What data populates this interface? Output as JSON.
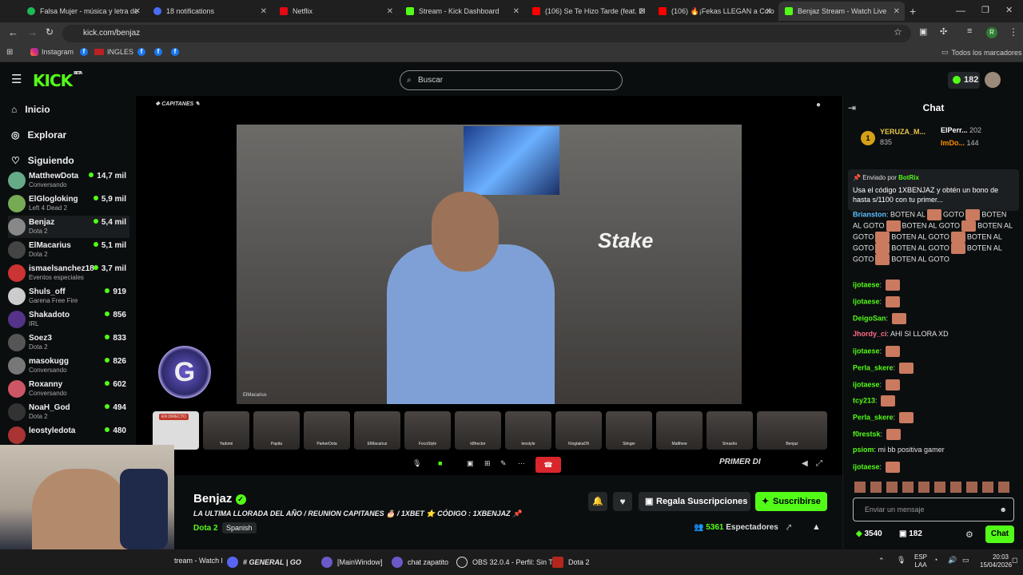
{
  "browser": {
    "tabs": [
      {
        "title": "Falsa Mujer - música y letra de",
        "color": "#1db954"
      },
      {
        "title": "18 notifications",
        "color": "#4a6cf7"
      },
      {
        "title": "Netflix",
        "color": "#e50914"
      },
      {
        "title": "Stream - Kick Dashboard",
        "color": "#53fc18"
      },
      {
        "title": "(106) Se Te Hizo Tarde (feat. El",
        "color": "#ff0000"
      },
      {
        "title": "(106) 🔥¡Fekas LLEGAN a Colo",
        "color": "#ff0000"
      },
      {
        "title": "Benjaz Stream - Watch Live",
        "color": "#53fc18"
      }
    ],
    "url": "kick.com/benjaz",
    "bookmarks": [
      "Instagram",
      "INGLES"
    ],
    "all_bookmarks": "Todos los marcadores"
  },
  "kick": {
    "logo": "KICK",
    "logo_beta": "BETA",
    "search_placeholder": "Buscar",
    "points": "182",
    "accent": "#53fc18"
  },
  "sidebar": {
    "nav": [
      "Inicio",
      "Explorar",
      "Siguiendo"
    ],
    "following": [
      {
        "name": "MatthewDota",
        "game": "Conversando",
        "viewers": "14,7 mil",
        "color": "#6a8"
      },
      {
        "name": "ElGlogloking",
        "game": "Left 4 Dead 2",
        "viewers": "5,9 mil",
        "color": "#7a5"
      },
      {
        "name": "Benjaz",
        "game": "Dota 2",
        "viewers": "5,4 mil",
        "color": "#888"
      },
      {
        "name": "ElMacarius",
        "game": "Dota 2",
        "viewers": "5,1 mil",
        "color": "#444"
      },
      {
        "name": "ismaelsanchez18",
        "game": "Eventos especiales",
        "viewers": "3,7 mil",
        "color": "#c33"
      },
      {
        "name": "Shuls_off",
        "game": "Garena Free Fire",
        "viewers": "919",
        "color": "#ccc"
      },
      {
        "name": "Shakadoto",
        "game": "IRL",
        "viewers": "856",
        "color": "#538"
      },
      {
        "name": "Soez3",
        "game": "Dota 2",
        "viewers": "833",
        "color": "#555"
      },
      {
        "name": "masokugg",
        "game": "Conversando",
        "viewers": "826",
        "color": "#777"
      },
      {
        "name": "Roxanny",
        "game": "Conversando",
        "viewers": "602",
        "color": "#c56"
      },
      {
        "name": "NoaH_God",
        "game": "Dota 2",
        "viewers": "494",
        "color": "#333"
      },
      {
        "name": "leostyledota",
        "game": "",
        "viewers": "480",
        "color": "#a33"
      }
    ]
  },
  "stream": {
    "overlay_title": "CAPITANES",
    "video_caption": "ElMacarius",
    "thumbs": [
      "EN DIRECTO",
      "Yadomi",
      "Papita",
      "ParkerDota",
      "ElMacarius",
      "FocoStyle",
      "k8hector",
      "leostyle",
      "KingtakaOfi",
      "Stinger",
      "Matthew",
      "Smasho",
      "Benjaz"
    ],
    "banner": "PRIMER DI",
    "streamer": "Benjaz",
    "title": "LA ULTIMA LLORADA DEL AÑO / REUNION CAPITANES 🎂 / 1XBET ⭐ CÓDIGO : 1XBENJAZ 📌",
    "game": "Dota 2",
    "language": "Spanish",
    "gift_label": "Regala Suscripciones",
    "subscribe_label": "Suscribirse",
    "viewers": "5361",
    "viewers_label": "Espectadores"
  },
  "chat": {
    "header": "Chat",
    "leaders": [
      {
        "rank": "1",
        "name": "YERUZA_M...",
        "count": "835"
      },
      {
        "name": "ElPerr...",
        "count": "202"
      },
      {
        "name": "ImDo...",
        "count": "144"
      }
    ],
    "pinned_by": "Enviado por",
    "pinned_user": "BotRix",
    "pinned_text": "Usa el código 1XBENJAZ y obtén un bono de hasta s/1100 con tu primer...",
    "messages": [
      {
        "user": "Brianston",
        "color": "#5ec1ff",
        "text": "BOTEN AL GOTO"
      },
      {
        "user": "ijotaese",
        "color": "#53fc18",
        "text": ""
      },
      {
        "user": "ijotaese",
        "color": "#53fc18",
        "text": ""
      },
      {
        "user": "DeigoSan",
        "color": "#53fc18",
        "text": ""
      },
      {
        "user": "Jhordy_ci",
        "color": "#ff6b8a",
        "text": "AHI SI LLORA XD"
      },
      {
        "user": "ijotaese",
        "color": "#53fc18",
        "text": ""
      },
      {
        "user": "Perla_skere",
        "color": "#53fc18",
        "text": ""
      },
      {
        "user": "ijotaese",
        "color": "#53fc18",
        "text": ""
      },
      {
        "user": "tcy213",
        "color": "#53fc18",
        "text": ""
      },
      {
        "user": "Perla_skere",
        "color": "#53fc18",
        "text": ""
      },
      {
        "user": "f0restsk",
        "color": "#53fc18",
        "text": ""
      },
      {
        "user": "psiom",
        "color": "#53fc18",
        "text": "mi bb positiva gamer"
      },
      {
        "user": "ijotaese",
        "color": "#53fc18",
        "text": ""
      }
    ],
    "boten_lines": [
      "BOTEN AL",
      "GOTO",
      "BOTEN AL GOTO",
      "BOTEN AL",
      "GOTO",
      "BOTEN AL GOTO",
      "BOTEN AL",
      "GOTO",
      "BOTEN AL GOTO",
      "BOTEN AL",
      "GOTO",
      "BOTEN AL GOTO",
      "BOTEN AL",
      "GOTO"
    ],
    "input_placeholder": "Enviar un mensaje",
    "kicks": "3540",
    "points": "182",
    "send_label": "Chat"
  },
  "taskbar": {
    "items": [
      "tream - Watch l",
      "# GENERAL | GO",
      "[MainWindow]",
      "chat zapatito",
      "OBS 32.0.4 - Perfil: Sin T",
      "Dota 2"
    ],
    "lang": "ESP",
    "lang2": "LAA",
    "time": "20:03",
    "date": "15/04/2026"
  }
}
